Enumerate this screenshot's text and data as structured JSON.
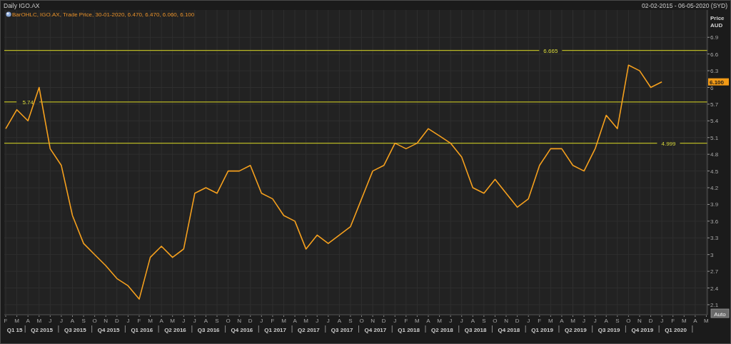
{
  "header": {
    "title": "Daily IGO.AX",
    "date_range": "02-02-2015 - 06-05-2020 (SYD)"
  },
  "chart": {
    "legend": "BarOHLC, IGO.AX, Trade Price, 30-01-2020, 6.470, 6.470, 6.060, 6.100",
    "quarters": [
      "Q1 15",
      "Q2 2015",
      "Q3 2015",
      "Q4 2015",
      "Q1 2016",
      "Q2 2016",
      "Q3 2016",
      "Q4 2016",
      "Q1 2017",
      "Q2 2017",
      "Q3 2017",
      "Q4 2017",
      "Q1 2018",
      "Q2 2018",
      "Q3 2018",
      "Q4 2018",
      "Q1 2019",
      "Q2 2019",
      "Q3 2019",
      "Q4 2019",
      "Q1 2020"
    ],
    "price_tag": "6.100",
    "auto_button": "Auto",
    "chart_data": {
      "type": "line",
      "ylabel": "Price AUD",
      "ylim": [
        1.92,
        7.39
      ],
      "grid": true,
      "ref_lines": [
        {
          "axis": "y",
          "value": 6.665,
          "label": "6.665"
        },
        {
          "axis": "y",
          "value": 5.74,
          "label": "5.74"
        },
        {
          "axis": "y",
          "value": 4.999,
          "label": "4.999"
        }
      ],
      "categories": [
        "F",
        "M",
        "A",
        "M",
        "J",
        "J",
        "A",
        "S",
        "O",
        "N",
        "D",
        "J",
        "F",
        "M",
        "A",
        "M",
        "J",
        "J",
        "A",
        "S",
        "O",
        "N",
        "D",
        "J",
        "F",
        "M",
        "A",
        "M",
        "J",
        "J",
        "A",
        "S",
        "O",
        "N",
        "D",
        "J",
        "F",
        "M",
        "A",
        "M",
        "J",
        "J",
        "A",
        "S",
        "O",
        "N",
        "D",
        "J",
        "F",
        "M",
        "A",
        "M",
        "J",
        "J",
        "A",
        "S",
        "O",
        "N",
        "D",
        "J",
        "F",
        "M",
        "A",
        "M"
      ],
      "series": [
        {
          "color": "#f5a01e",
          "values": [
            5.26,
            5.6,
            5.4,
            6.0,
            4.9,
            4.6,
            3.7,
            3.2,
            3.0,
            2.8,
            2.57,
            2.44,
            2.2,
            2.95,
            3.15,
            2.95,
            3.1,
            4.1,
            4.2,
            4.1,
            4.5,
            4.5,
            4.6,
            4.1,
            4.0,
            3.7,
            3.6,
            3.1,
            3.35,
            3.2,
            3.35,
            3.5,
            4.0,
            4.5,
            4.6,
            5.0,
            4.9,
            5.0,
            5.26,
            5.13,
            5.0,
            4.75,
            4.2,
            4.1,
            4.35,
            4.1,
            3.85,
            4.0,
            4.6,
            4.9,
            4.9,
            4.6,
            4.5,
            4.9,
            5.5,
            5.26,
            6.4,
            6.3,
            6.0,
            6.1,
            null,
            null,
            null,
            null
          ]
        }
      ],
      "yticks": [
        6.9,
        6.6,
        6.3,
        6,
        5.7,
        5.4,
        5.1,
        4.8,
        4.5,
        4.2,
        3.9,
        3.6,
        3.3,
        3,
        2.7,
        2.4,
        2.1
      ]
    }
  }
}
